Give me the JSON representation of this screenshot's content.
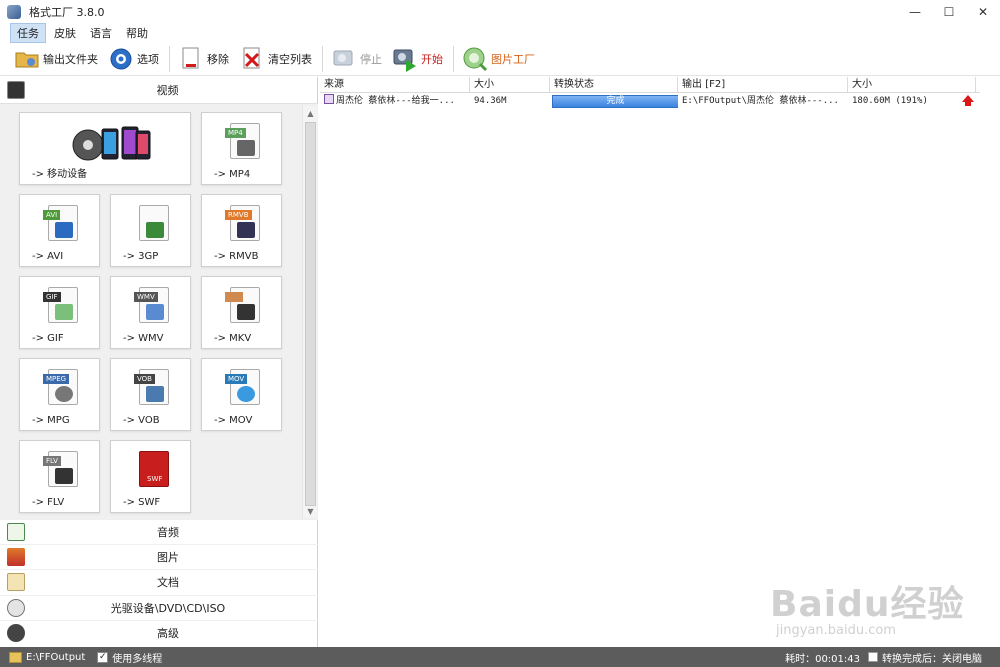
{
  "window": {
    "title": "格式工厂 3.8.0",
    "controls": [
      "—",
      "☐",
      "✕"
    ]
  },
  "menu": [
    "任务",
    "皮肤",
    "语言",
    "帮助"
  ],
  "toolbar": {
    "output_folder": "输出文件夹",
    "options": "选项",
    "remove": "移除",
    "clear_list": "清空列表",
    "stop": "停止",
    "start": "开始",
    "picture_factory": "图片工厂"
  },
  "sidebar": {
    "video_title": "视频",
    "tiles": [
      {
        "label": "-> 移动设备",
        "tag": "",
        "tag_color": ""
      },
      {
        "label": "-> MP4",
        "tag": "MP4",
        "tag_color": "#5aa05a"
      },
      {
        "label": "-> AVI",
        "tag": "AVI",
        "tag_color": "#4e9a3a"
      },
      {
        "label": "-> 3GP",
        "tag": "",
        "tag_color": "#3a8a3a"
      },
      {
        "label": "-> RMVB",
        "tag": "RMVB",
        "tag_color": "#e07a2a"
      },
      {
        "label": "-> GIF",
        "tag": "GIF",
        "tag_color": "#333333"
      },
      {
        "label": "-> WMV",
        "tag": "WMV",
        "tag_color": "#555555"
      },
      {
        "label": "-> MKV",
        "tag": "",
        "tag_color": "#d08a50"
      },
      {
        "label": "-> MPG",
        "tag": "MPEG",
        "tag_color": "#3a6aaa"
      },
      {
        "label": "-> VOB",
        "tag": "VOB",
        "tag_color": "#444444"
      },
      {
        "label": "-> MOV",
        "tag": "MOV",
        "tag_color": "#2a7ab8"
      },
      {
        "label": "-> FLV",
        "tag": "FLV",
        "tag_color": "#777777"
      },
      {
        "label": "-> SWF",
        "tag": "SWF",
        "tag_color": "#c81e1e"
      }
    ],
    "categories": [
      "音频",
      "图片",
      "文档",
      "光驱设备\\DVD\\CD\\ISO",
      "高级"
    ]
  },
  "table": {
    "headers": [
      "来源",
      "大小",
      "转换状态",
      "输出 [F2]",
      "大小"
    ],
    "rows": [
      {
        "source": "周杰伦  蔡依林---给我一...",
        "size": "94.36M",
        "status": "完成",
        "output": "E:\\FFOutput\\周杰伦  蔡依林---...",
        "out_size": "180.60M  (191%)"
      }
    ]
  },
  "statusbar": {
    "output_path": "E:\\FFOutput",
    "multithread": "使用多线程",
    "elapsed": "耗时：00:01:43",
    "after_done": "转换完成后：关闭电脑"
  },
  "watermark": {
    "brand": "Baidu经验",
    "url": "jingyan.baidu.com"
  }
}
